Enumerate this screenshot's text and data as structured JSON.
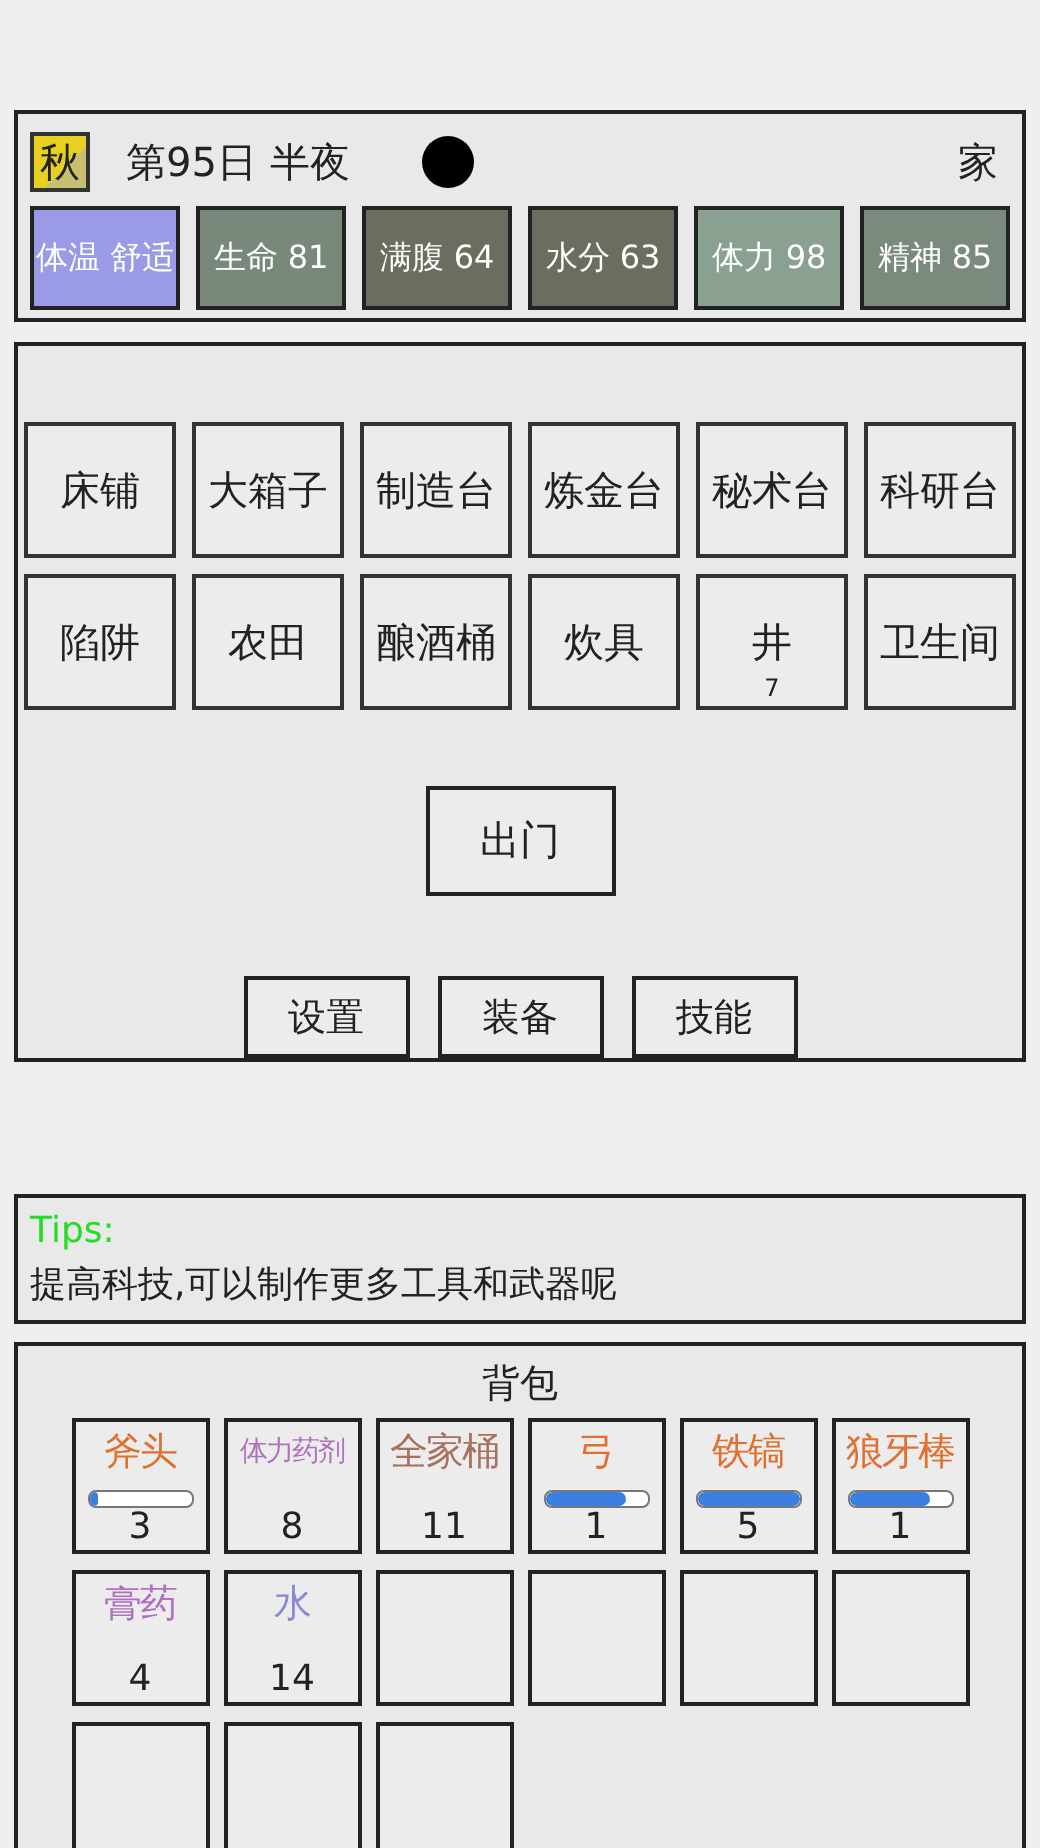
{
  "header": {
    "season": "秋",
    "day": "第95日 半夜",
    "location": "家"
  },
  "stats": [
    {
      "label": "体温 舒适",
      "color": "#9a9ae6"
    },
    {
      "label": "生命 81",
      "color": "#78887a"
    },
    {
      "label": "满腹 64",
      "color": "#6a6e5e"
    },
    {
      "label": "水分 63",
      "color": "#6a6e5e"
    },
    {
      "label": "体力 98",
      "color": "#8aa090"
    },
    {
      "label": "精神 85",
      "color": "#7a8a7c"
    }
  ],
  "buildings": [
    {
      "label": "床铺"
    },
    {
      "label": "大箱子"
    },
    {
      "label": "制造台"
    },
    {
      "label": "炼金台"
    },
    {
      "label": "秘术台"
    },
    {
      "label": "科研台"
    },
    {
      "label": "陷阱"
    },
    {
      "label": "农田"
    },
    {
      "label": "酿酒桶"
    },
    {
      "label": "炊具"
    },
    {
      "label": "井",
      "count": "7"
    },
    {
      "label": "卫生间"
    }
  ],
  "exit_button": "出门",
  "menu_buttons": [
    "设置",
    "装备",
    "技能"
  ],
  "tips": {
    "title": "Tips:",
    "text": "提高科技,可以制作更多工具和武器呢"
  },
  "backpack": {
    "title": "背包",
    "slots": [
      {
        "kind": "item",
        "name": "斧头",
        "color": "#e07030",
        "level": 0.08,
        "count": "3"
      },
      {
        "kind": "item",
        "name": "体力药剂",
        "color": "#b070c0",
        "count": "8"
      },
      {
        "kind": "item",
        "name": "全家桶",
        "color": "#a87060",
        "count": "11"
      },
      {
        "kind": "item",
        "name": "弓",
        "color": "#e07030",
        "level": 0.8,
        "count": "1"
      },
      {
        "kind": "item",
        "name": "铁镐",
        "color": "#e07030",
        "level": 1,
        "count": "5"
      },
      {
        "kind": "item",
        "name": "狼牙棒",
        "color": "#e07030",
        "level": 0.8,
        "count": "1"
      },
      {
        "kind": "item",
        "name": "膏药",
        "color": "#b070c0",
        "count": "4"
      },
      {
        "kind": "item",
        "name": "水",
        "color": "#8888d8",
        "count": "14"
      },
      {
        "kind": "empty"
      },
      {
        "kind": "empty"
      },
      {
        "kind": "empty"
      },
      {
        "kind": "empty"
      },
      {
        "kind": "empty"
      },
      {
        "kind": "empty"
      },
      {
        "kind": "empty"
      }
    ]
  }
}
